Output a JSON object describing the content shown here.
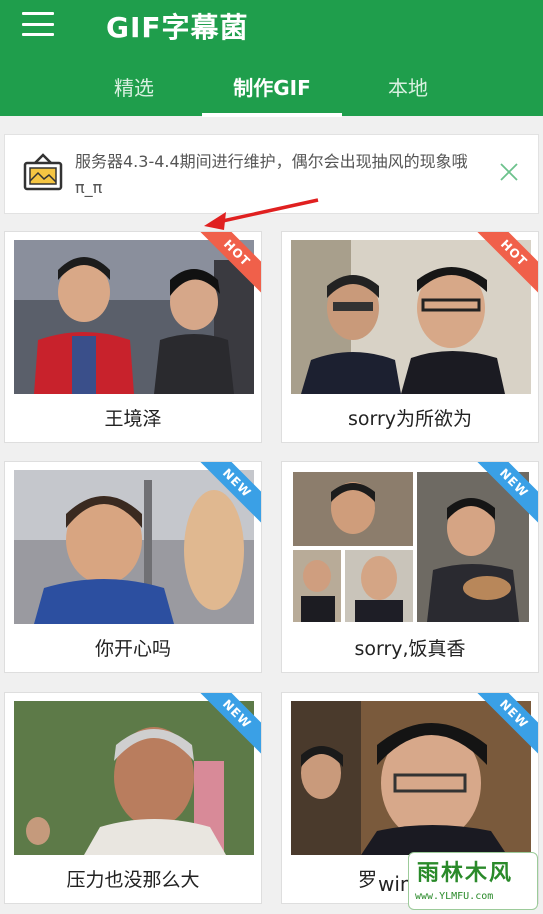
{
  "app": {
    "title": "GIF字幕菌"
  },
  "tabs": [
    {
      "label": "精选",
      "active": false
    },
    {
      "label": "制作GIF",
      "active": true
    },
    {
      "label": "本地",
      "active": false
    }
  ],
  "notice": {
    "text": "服务器4.3-4.4期间进行维护，偶尔会出现抽风的现象哦 π_π"
  },
  "cards": [
    {
      "caption": "王境泽",
      "badge": "HOT"
    },
    {
      "caption": "sorry为所欲为",
      "badge": "HOT"
    },
    {
      "caption": "你开心吗",
      "badge": "NEW"
    },
    {
      "caption": "sorry,饭真香",
      "badge": "NEW"
    },
    {
      "caption": "压力也没那么大",
      "badge": "NEW"
    },
    {
      "caption": "罗",
      "badge": "NEW"
    }
  ],
  "watermark": {
    "prefix": "win",
    "main": "雨林木风",
    "url": "www.YLMFU.com"
  },
  "colors": {
    "primary": "#1f9e4c",
    "hot": "#f0604a",
    "new": "#3aa0e6",
    "arrow": "#e02020"
  },
  "icons": {
    "menu": "hamburger-menu-icon",
    "notice": "image-notice-icon",
    "close": "close-icon"
  }
}
